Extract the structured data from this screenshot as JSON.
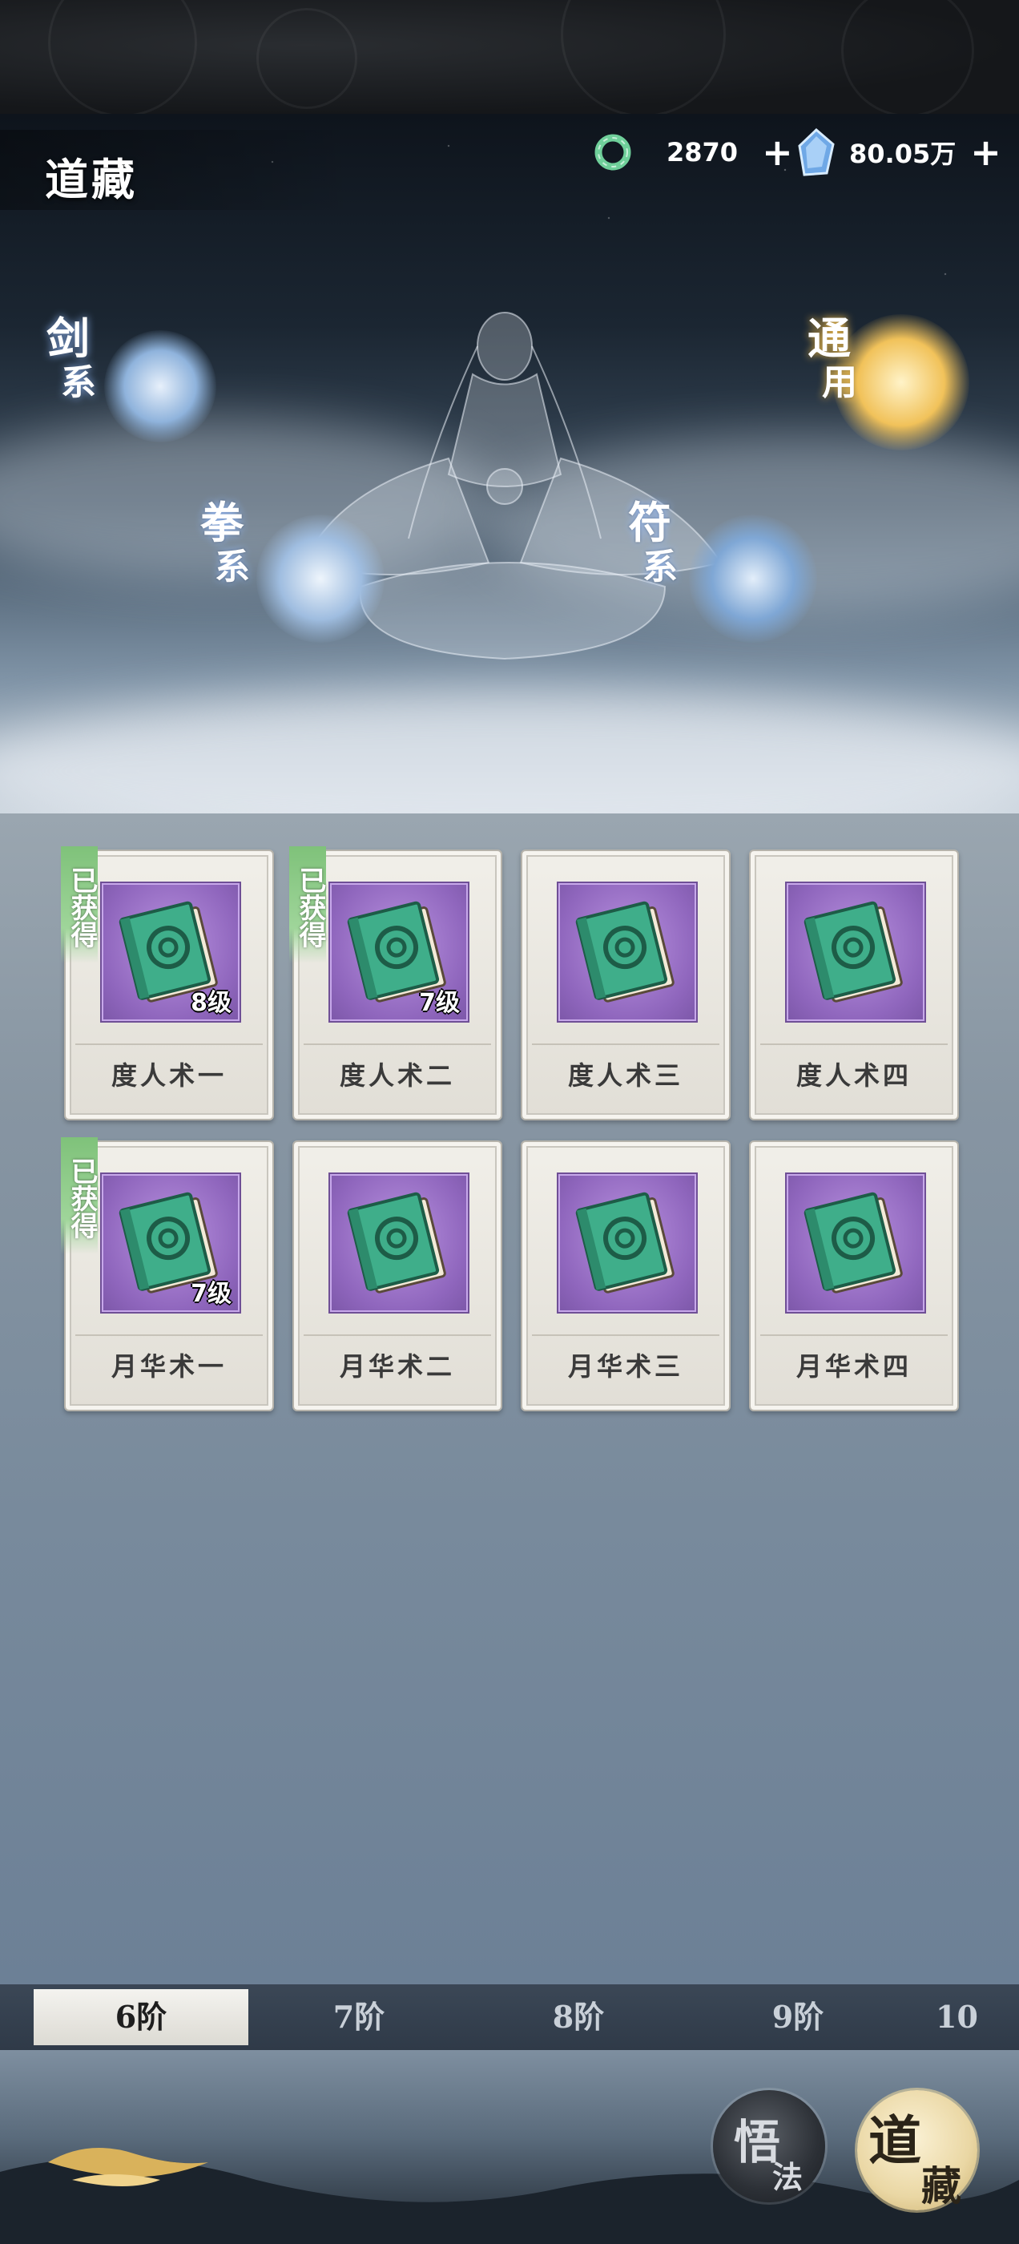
{
  "header": {
    "title": "道藏",
    "currency_jade": {
      "icon": "jade-ring-icon",
      "value": "2870",
      "plus": "+"
    },
    "currency_crystal": {
      "icon": "blue-crystal-icon",
      "value": "80.05万",
      "plus": "+"
    }
  },
  "hero": {
    "schools": [
      {
        "top": "剑",
        "bottom": "系",
        "name": "sword"
      },
      {
        "top": "拳",
        "bottom": "系",
        "name": "fist"
      },
      {
        "top": "符",
        "bottom": "系",
        "name": "talisman"
      },
      {
        "top": "通",
        "bottom": "用",
        "name": "general"
      }
    ]
  },
  "cards": [
    {
      "name": "度人术一",
      "obtained": true,
      "obtained_label": "已获得",
      "level": "8级"
    },
    {
      "name": "度人术二",
      "obtained": true,
      "obtained_label": "已获得",
      "level": "7级"
    },
    {
      "name": "度人术三",
      "obtained": false
    },
    {
      "name": "度人术四",
      "obtained": false
    },
    {
      "name": "月华术一",
      "obtained": true,
      "obtained_label": "已获得",
      "level": "7级"
    },
    {
      "name": "月华术二",
      "obtained": false
    },
    {
      "name": "月华术三",
      "obtained": false
    },
    {
      "name": "月华术四",
      "obtained": false
    }
  ],
  "tabs": [
    {
      "label": "6阶",
      "active": true
    },
    {
      "label": "7阶",
      "active": false
    },
    {
      "label": "8阶",
      "active": false
    },
    {
      "label": "9阶",
      "active": false
    },
    {
      "label": "10",
      "active": false
    }
  ],
  "footer": {
    "enlighten_button": {
      "t1": "悟",
      "t2": "法"
    },
    "daozang_button": {
      "t1": "道",
      "t2": "藏"
    }
  },
  "colors": {
    "card_icon_bg": "#9a70c8",
    "book_green": "#3fae8a",
    "obtained_badge": "#8fcb89",
    "gold_orb": "#f1c25a",
    "blue_orb": "#8fb3dc"
  }
}
